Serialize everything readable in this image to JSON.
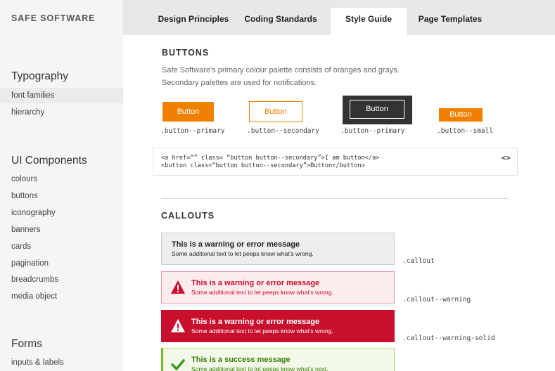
{
  "sidebar": {
    "brand": "SAFE SOFTWARE",
    "typography_heading": "Typography",
    "typography_items": [
      "font families",
      "hierarchy"
    ],
    "components_heading": "UI Components",
    "components_items": [
      "colours",
      "buttons",
      "iconography",
      "banners",
      "cards",
      "pagination",
      "breadcrumbs",
      "media object"
    ],
    "forms_heading": "Forms",
    "forms_items": [
      "inputs & labels"
    ]
  },
  "tabs": [
    "Design Principles",
    "Coding Standards",
    "Style Guide",
    "Page Templates"
  ],
  "active_tab": "Style Guide",
  "buttons_section": {
    "title": "BUTTONS",
    "description": [
      "Safe Software's primary colour palette consists of oranges and grays.",
      "Secondary palettes are used for notifications."
    ],
    "button_label": "Button",
    "captions": [
      ".button--primary",
      ".button--secondary",
      ".button--primary",
      ".button--small"
    ],
    "code_lines": [
      "<a href=“” class= “button button--secondary”>I am button</a>",
      "<button class=“button button--secondary”>Button</button>"
    ],
    "code_toggle": "<>"
  },
  "callouts_section": {
    "title": "CALLOUTS",
    "callouts": [
      {
        "title": "This is a warning or error message",
        "text": "Some additional text to let peeps know what's wrong.",
        "caption": ".callout"
      },
      {
        "title": "This is a warning or error message",
        "text": "Some additional text to let peeps know what's wrong.",
        "caption": ".callout--warning",
        "icon": "warning-icon"
      },
      {
        "title": "This is a warning or error message",
        "text": "Some additional text to let peeps know what's wrong.",
        "caption": ".callout--warning-solid",
        "icon": "warning-icon"
      },
      {
        "title": "This is a success message",
        "text": "Some additional text to let peeps know what's next.",
        "icon": "checkmark-icon"
      }
    ]
  },
  "colors": {
    "orange": "#f08000",
    "dark": "#333333",
    "warning_red": "#c8102e",
    "success_green": "#76b82a"
  }
}
